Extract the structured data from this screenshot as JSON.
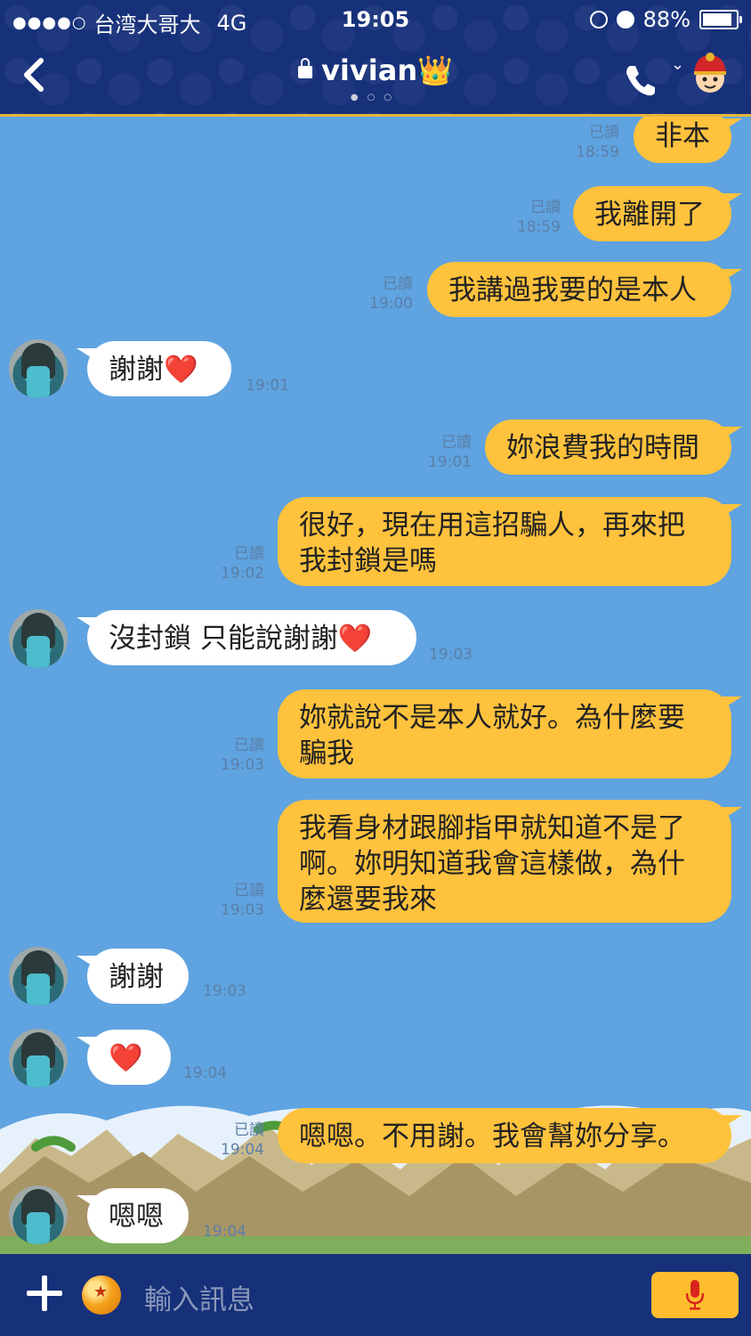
{
  "statusbar": {
    "carrier": "台湾大哥大",
    "network": "4G",
    "time": "19:05",
    "battery": "88%"
  },
  "header": {
    "contact_name": "vivian👑"
  },
  "messages": [
    {
      "dir": "out",
      "text": "非本",
      "read": "已讀",
      "time": "18:59"
    },
    {
      "dir": "out",
      "text": "我離開了",
      "read": "已讀",
      "time": "18:59"
    },
    {
      "dir": "out",
      "text": "我講過我要的是本人",
      "read": "已讀",
      "time": "19:00"
    },
    {
      "dir": "in",
      "text": "謝謝❤️",
      "time": "19:01"
    },
    {
      "dir": "out",
      "text": "妳浪費我的時間",
      "read": "已讀",
      "time": "19:01"
    },
    {
      "dir": "out",
      "text": "很好，現在用這招騙人，再來把\n我封鎖是嗎",
      "read": "已讀",
      "time": "19:02"
    },
    {
      "dir": "in",
      "text": "沒封鎖 只能說謝謝❤️",
      "time": "19:03"
    },
    {
      "dir": "out",
      "text": "妳就說不是本人就好。為什麼要\n騙我",
      "read": "已讀",
      "time": "19:03"
    },
    {
      "dir": "out",
      "text": "我看身材跟腳指甲就知道不是了\n啊。妳明知道我會這樣做，為什\n麼還要我來",
      "read": "已讀",
      "time": "19:03"
    },
    {
      "dir": "in",
      "text": "謝謝",
      "time": "19:03"
    },
    {
      "dir": "in",
      "text": "❤️",
      "time": "19:04"
    },
    {
      "dir": "out",
      "text": "嗯嗯。不用謝。我會幫妳分享。",
      "read": "已讀",
      "time": "19:04"
    },
    {
      "dir": "in",
      "text": "嗯嗯",
      "time": "19:04"
    }
  ],
  "input": {
    "placeholder": "輸入訊息"
  },
  "colors": {
    "header_bg": "#16307a",
    "chat_bg": "#5fa3e0",
    "outgoing_bubble": "#ffc23d",
    "incoming_bubble": "#ffffff",
    "accent": "#ffbd2e"
  }
}
